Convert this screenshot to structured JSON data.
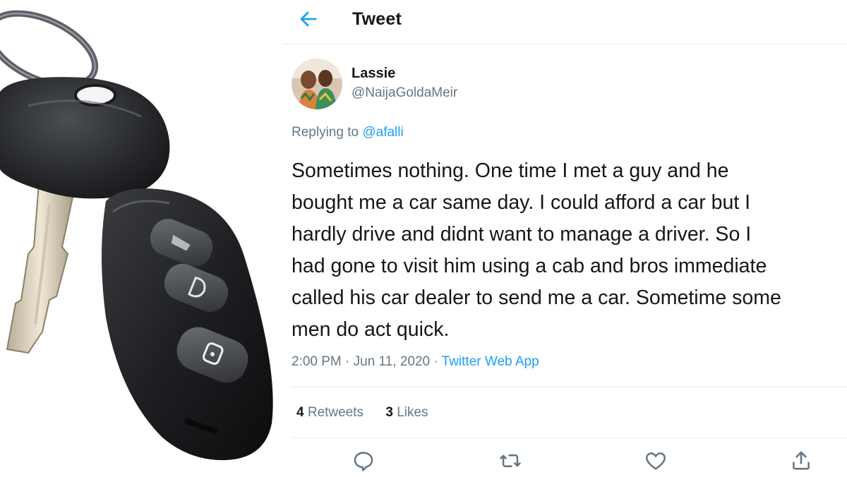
{
  "header": {
    "title": "Tweet",
    "back_icon": "back-arrow-icon"
  },
  "tweet": {
    "author_name": "Lassie",
    "author_handle": "@NaijaGoldaMeir",
    "reply_prefix": "Replying to",
    "reply_to": "@afalli",
    "text": "Sometimes nothing. One time I met a guy and he\nbought me a car same day. I could afford a car but I\nhardly drive and didnt want to manage a driver. So I\nhad gone to visit him using a cab and bros immediate\ncalled his car dealer to send me a car. Sometime some\nmen do act quick.",
    "timestamp": "2:00 PM · Jun 11, 2020 · ",
    "source_app": "Twitter Web App",
    "retweets_count": "4",
    "retweets_label": "Retweets",
    "likes_count": "3",
    "likes_label": "Likes"
  },
  "actions": [
    {
      "icon": "reply-icon"
    },
    {
      "icon": "retweet-icon"
    },
    {
      "icon": "like-heart-icon"
    },
    {
      "icon": "share-icon"
    }
  ],
  "colors": {
    "accent": "#1da1f2",
    "secondary_text": "#657786",
    "primary_text": "#14171a",
    "divider": "#e6ecf0"
  }
}
